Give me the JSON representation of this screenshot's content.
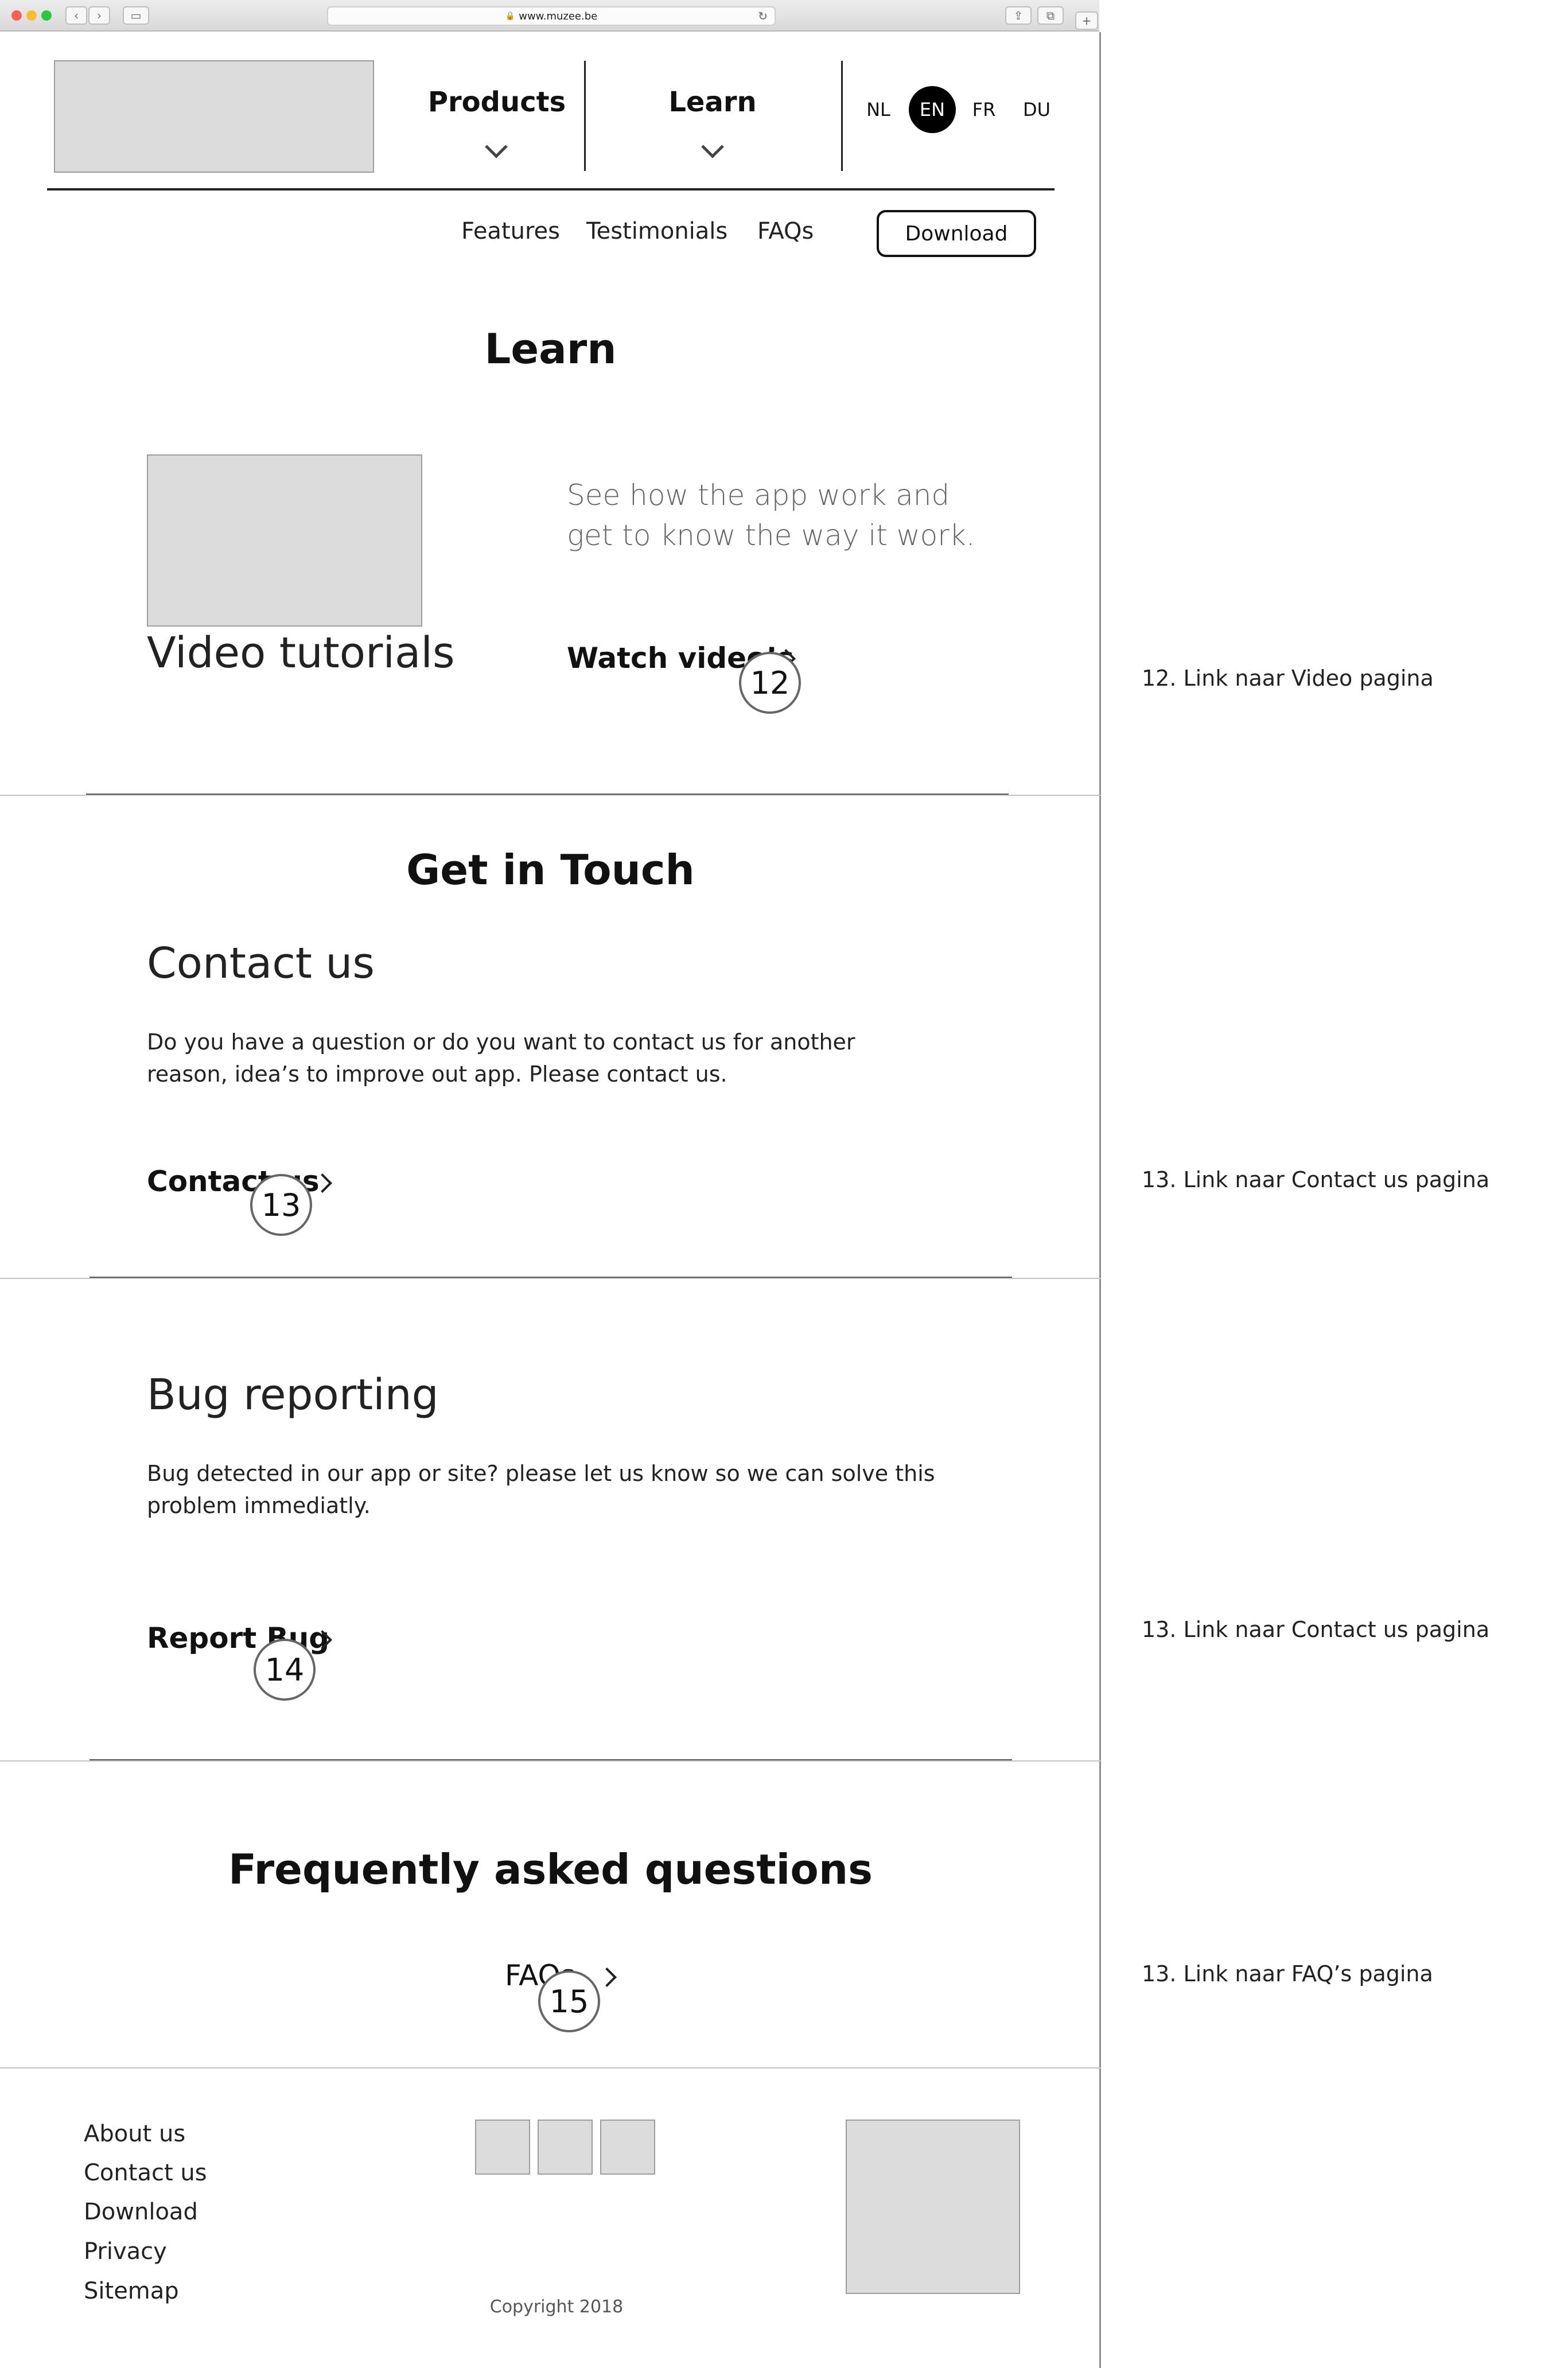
{
  "browser": {
    "url": "www.muzee.be"
  },
  "header": {
    "nav": [
      {
        "label": "Products",
        "icon": "chevron-down-icon"
      },
      {
        "label": "Learn",
        "icon": "chevron-down-icon"
      }
    ],
    "languages": [
      "NL",
      "EN",
      "FR",
      "DU"
    ],
    "active_language": "EN"
  },
  "subnav": {
    "links": [
      "Features",
      "Testimonials",
      "FAQs"
    ],
    "download_label": "Download"
  },
  "learn": {
    "title": "Learn",
    "video_heading": "Video tutorials",
    "description": "See how the app work and get to know the way it work.",
    "link_label": "Watch video’s",
    "badge": "12"
  },
  "touch": {
    "title": "Get in Touch",
    "contact_heading": "Contact us",
    "contact_text": "Do you have a question or do you want to contact us for another reason, idea’s to improve out app. Please contact us.",
    "contact_link": "Contact us",
    "contact_badge": "13",
    "bug_heading": "Bug reporting",
    "bug_text": "Bug detected in our app or site? please let us know so we can solve this problem immediatly.",
    "bug_link": "Report Bug",
    "bug_badge": "14"
  },
  "faq": {
    "title": "Frequently asked questions",
    "link_label": "FAQs",
    "badge": "15"
  },
  "footer": {
    "links": [
      "About us",
      "Contact us",
      "Download",
      "Privacy",
      "Sitemap"
    ],
    "copyright": "Copyright 2018"
  },
  "annotations": [
    "12. Link naar Video pagina",
    "13. Link naar Contact us pagina",
    "13. Link naar Contact us pagina",
    "13. Link naar FAQ’s pagina"
  ]
}
